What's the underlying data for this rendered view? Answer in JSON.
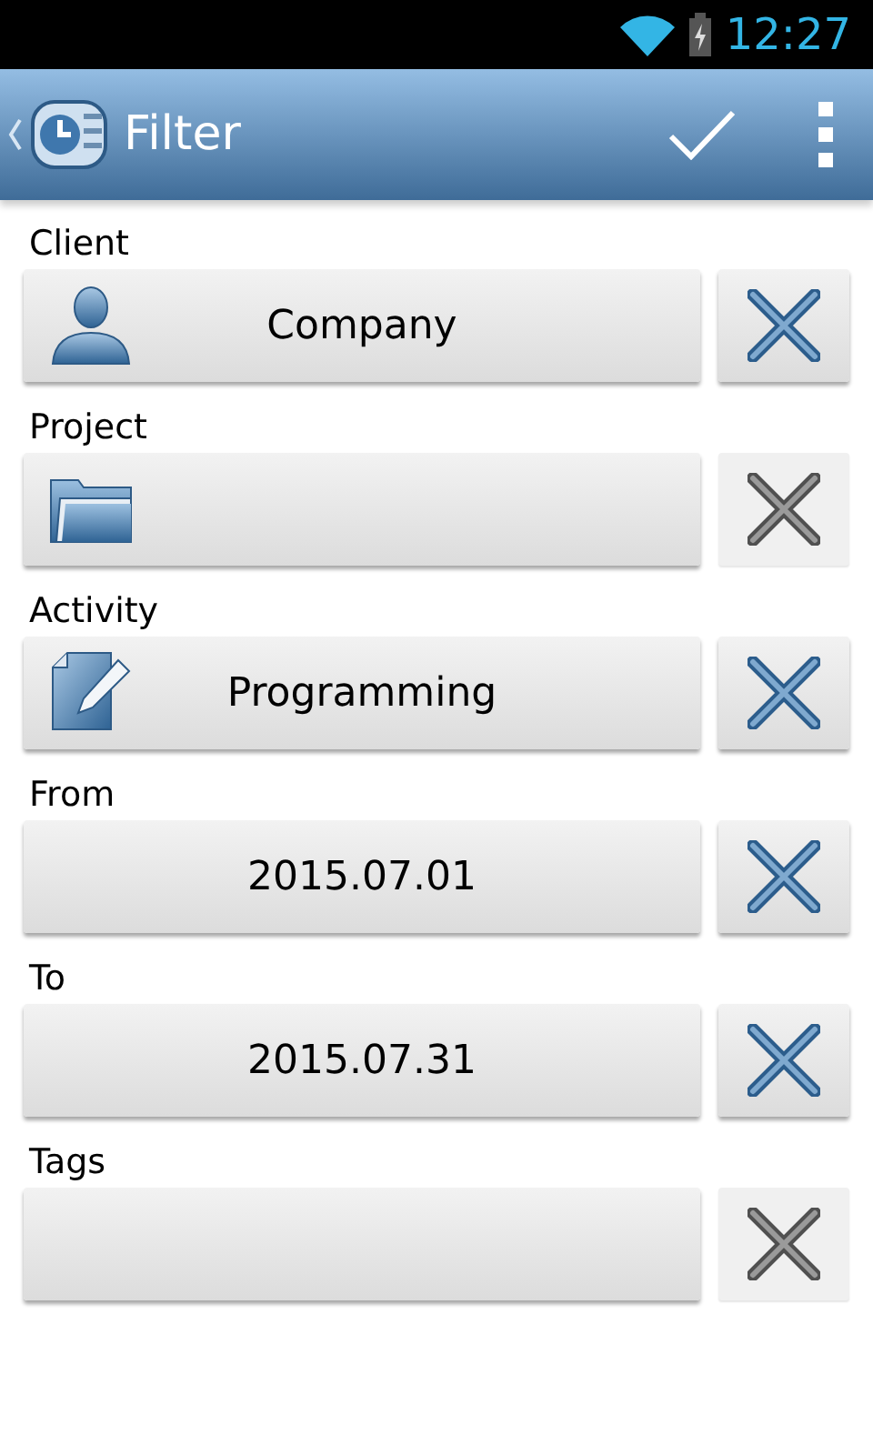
{
  "status_bar": {
    "time": "12:27"
  },
  "action_bar": {
    "title": "Filter"
  },
  "fields": [
    {
      "label": "Client",
      "value": "Company",
      "kind": "client",
      "clear_enabled": true
    },
    {
      "label": "Project",
      "kind": "project",
      "clear_enabled": false
    },
    {
      "label": "Activity",
      "value": "Programming",
      "kind": "activity",
      "clear_enabled": true
    },
    {
      "label": "From",
      "value": "2015.07.01",
      "kind": "date",
      "clear_enabled": true
    },
    {
      "label": "To",
      "value": "2015.07.31",
      "kind": "date",
      "clear_enabled": true
    },
    {
      "label": "Tags",
      "kind": "tags",
      "clear_enabled": false
    }
  ]
}
